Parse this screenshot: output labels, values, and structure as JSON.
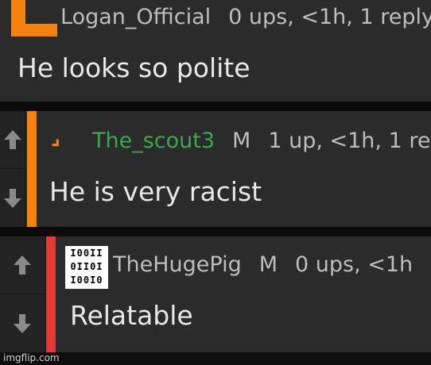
{
  "comments": [
    {
      "username": "Logan_Official",
      "flair": "",
      "stats": "0 ups, <1h, 1 reply",
      "text": "He looks so polite",
      "avatar_icon": "orange-letter-L-icon",
      "accent_color": "#f7810e"
    },
    {
      "username": "The_scout3",
      "flair": "M",
      "stats": "1 up, <1h, 1 re",
      "text": "He is very racist",
      "avatar_icon": "orange-bolt-icon",
      "accent_color": "#f7810e"
    },
    {
      "username": "TheHugePig",
      "flair": "M",
      "stats": "0 ups, <1h",
      "text": "Relatable",
      "avatar_icon": "binary-code-icon",
      "avatar_rows": [
        "I00II",
        "0II0I",
        "I00I0"
      ],
      "accent_color": "#e53935"
    }
  ],
  "watermark": "imgflip.com"
}
